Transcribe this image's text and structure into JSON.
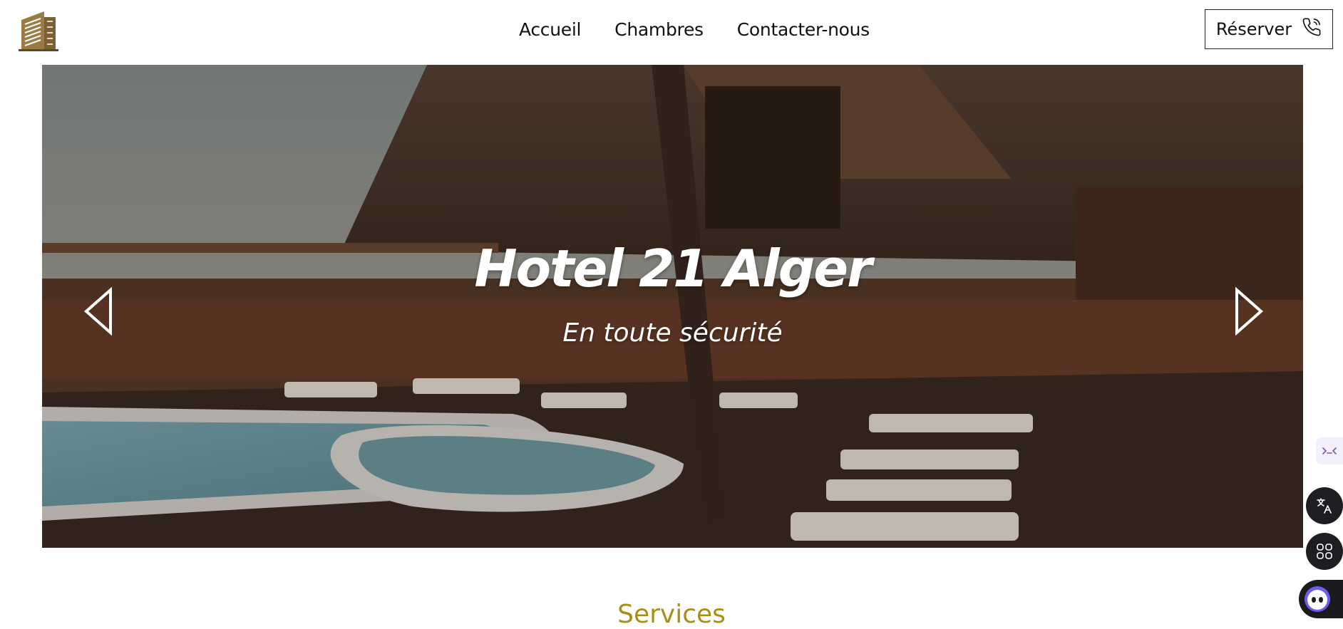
{
  "header": {
    "logo_icon": "hotel-building-logo",
    "nav": [
      {
        "label": "Accueil"
      },
      {
        "label": "Chambres"
      },
      {
        "label": "Contacter-nous"
      }
    ],
    "reserve_button": {
      "label": "Réserver",
      "icon": "phone-call-icon"
    }
  },
  "hero": {
    "title": "Hotel 21 Alger",
    "subtitle": "En toute sécurité",
    "prev_icon": "chevron-left-icon",
    "next_icon": "chevron-right-icon"
  },
  "services": {
    "title": "Services"
  },
  "floating": {
    "tab_icon": "expand-arrows-icon",
    "translate_icon": "translate-icon",
    "apps_icon": "apps-grid-icon",
    "assistant_icon": "assistant-avatar-icon"
  },
  "colors": {
    "accent": "#a89018",
    "logo": "#9a7b47",
    "text": "#111111",
    "widget_dark": "#1e1e22"
  }
}
